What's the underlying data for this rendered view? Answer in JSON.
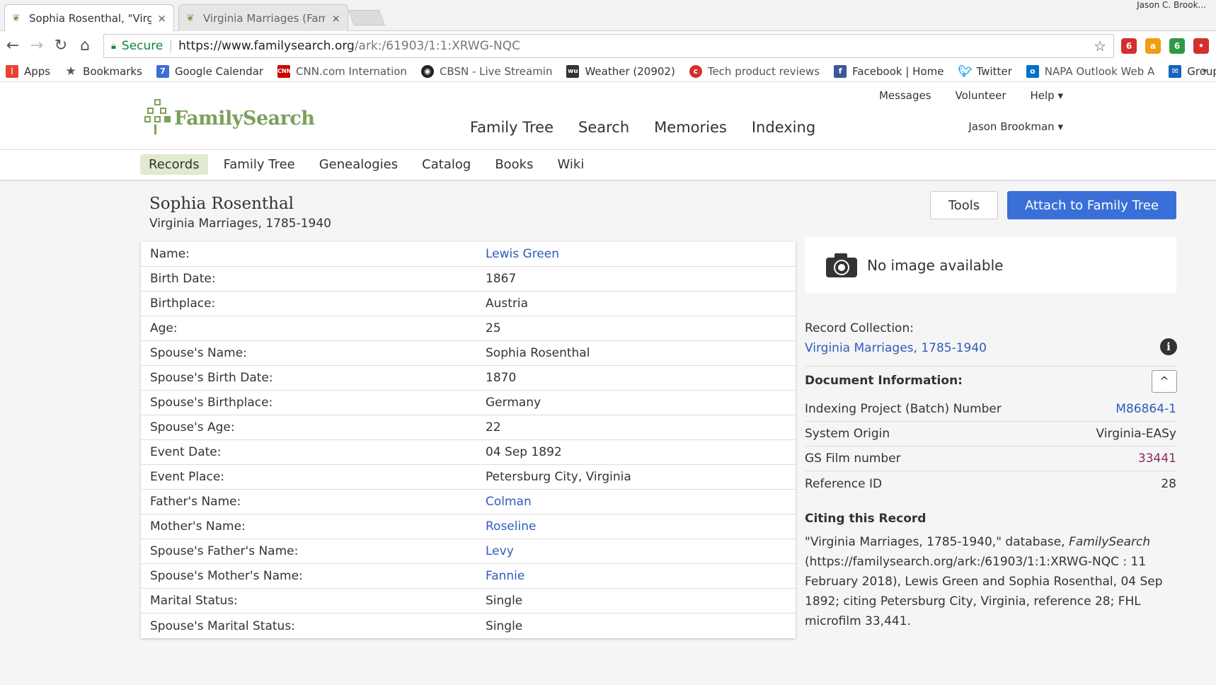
{
  "browser": {
    "tabs": [
      {
        "title": "Sophia Rosenthal, \"Virgin",
        "close": "×"
      },
      {
        "title": "Virginia Marriages (Famil",
        "close": "×"
      }
    ],
    "profile_name": "Jason C. Brook...",
    "omnibox": {
      "secure_label": "Secure",
      "url_host": "https://www.familysearch.org",
      "url_path": "/ark:/61903/1:1:XRWG-NQC"
    },
    "bookmarks": [
      {
        "label": "Apps",
        "icon": "apps-grid-icon",
        "color": "#e94235"
      },
      {
        "label": "Bookmarks",
        "icon": "star-icon",
        "color": "#555555"
      },
      {
        "label": "Google Calendar",
        "icon": "calendar-icon",
        "color": "#3b6fd8"
      },
      {
        "label": "CNN.com Internation",
        "icon": "cnn-icon",
        "color": "#cc0000"
      },
      {
        "label": "CBSN - Live Streamin",
        "icon": "cbs-eye-icon",
        "color": "#222222"
      },
      {
        "label": "Weather (20902)",
        "icon": "weather-icon",
        "color": "#333333"
      },
      {
        "label": "Tech product reviews",
        "icon": "cnet-icon",
        "color": "#d32f2f"
      },
      {
        "label": "Facebook | Home",
        "icon": "facebook-icon",
        "color": "#3b5998"
      },
      {
        "label": "Twitter",
        "icon": "twitter-icon",
        "color": "#1da1f2"
      },
      {
        "label": "NAPA Outlook Web A",
        "icon": "outlook-icon",
        "color": "#0072c6"
      },
      {
        "label": "GroupWise",
        "icon": "mail-icon",
        "color": "#1565c0"
      }
    ],
    "bookmarks_more": "»"
  },
  "site": {
    "logo_text": "FamilySearch",
    "main_nav": [
      "Family Tree",
      "Search",
      "Memories",
      "Indexing"
    ],
    "util_nav": {
      "messages": "Messages",
      "volunteer": "Volunteer",
      "help": "Help ▾"
    },
    "user": "Jason Brookman ▾",
    "sub_nav": [
      "Records",
      "Family Tree",
      "Genealogies",
      "Catalog",
      "Books",
      "Wiki"
    ]
  },
  "record": {
    "title": "Sophia Rosenthal",
    "collection": "Virginia Marriages, 1785-1940",
    "tools_button": "Tools",
    "attach_button": "Attach to Family Tree",
    "fields": [
      {
        "label": "Name:",
        "value": "Lewis Green"
      },
      {
        "label": "Birth Date:",
        "value": "1867"
      },
      {
        "label": "Birthplace:",
        "value": "Austria"
      },
      {
        "label": "Age:",
        "value": "25"
      },
      {
        "label": "Spouse's Name:",
        "value": "Sophia Rosenthal"
      },
      {
        "label": "Spouse's Birth Date:",
        "value": "1870"
      },
      {
        "label": "Spouse's Birthplace:",
        "value": "Germany"
      },
      {
        "label": "Spouse's Age:",
        "value": "22"
      },
      {
        "label": "Event Date:",
        "value": "04 Sep 1892"
      },
      {
        "label": "Event Place:",
        "value": "Petersburg City, Virginia"
      },
      {
        "label": "Father's Name:",
        "value": "Colman"
      },
      {
        "label": "Mother's Name:",
        "value": "Roseline"
      },
      {
        "label": "Spouse's Father's Name:",
        "value": "Levy"
      },
      {
        "label": "Spouse's Mother's Name:",
        "value": "Fannie"
      },
      {
        "label": "Marital Status:",
        "value": "Single"
      },
      {
        "label": "Spouse's Marital Status:",
        "value": "Single"
      }
    ]
  },
  "sidebar": {
    "no_image": "No image available",
    "record_collection_label": "Record Collection:",
    "record_collection_link": "Virginia Marriages, 1785-1940",
    "doc_info_heading": "Document Information:",
    "collapse_symbol": "^",
    "doc_rows": [
      {
        "label": "Indexing Project (Batch) Number",
        "value": "M86864-1"
      },
      {
        "label": "System Origin",
        "value": "Virginia-EASy"
      },
      {
        "label": "GS Film number",
        "value": "33441"
      },
      {
        "label": "Reference ID",
        "value": "28"
      }
    ],
    "citing_heading": "Citing this Record",
    "citation_pre": "\"Virginia Marriages, 1785-1940,\" database, ",
    "citation_em": "FamilySearch",
    "citation_post": " (https://familysearch.org/ark:/61903/1:1:XRWG-NQC : 11 February 2018), Lewis Green and Sophia Rosenthal, 04 Sep 1892; citing Petersburg City, Virginia, reference 28; FHL microfilm 33,441."
  },
  "colors": {
    "link": "#2f5bbd",
    "visited": "#8a2d5e",
    "brand_green": "#7ba05b",
    "primary_button": "#3a6fd8",
    "active_subnav": "#dfeacf"
  }
}
